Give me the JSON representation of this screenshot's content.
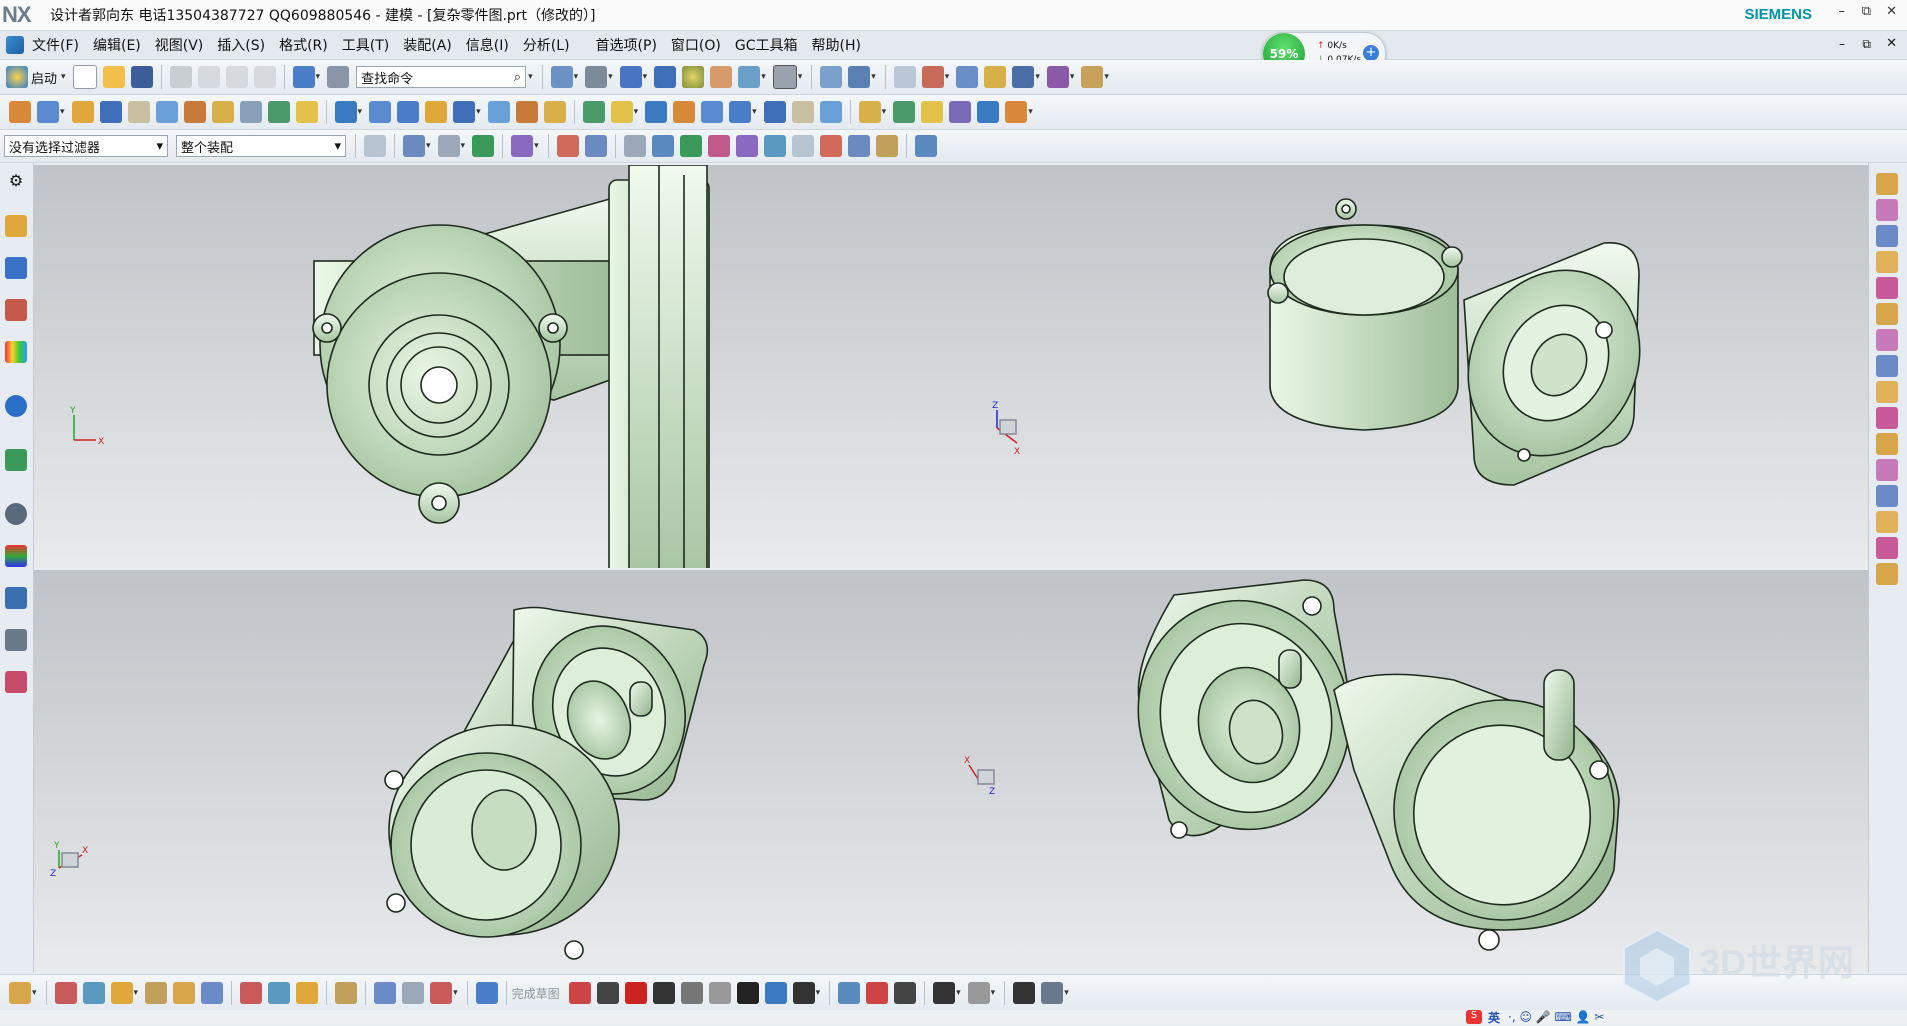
{
  "titlebar": {
    "logo": "NX",
    "title": "设计者郭向东  电话13504387727  QQ609880546 - 建模 - [复杂零件图.prt（修改的）]",
    "brand": "SIEMENS",
    "minimize": "–",
    "restore": "⧉",
    "close": "✕"
  },
  "menubar": {
    "items": [
      "文件(F)",
      "编辑(E)",
      "视图(V)",
      "插入(S)",
      "格式(R)",
      "工具(T)",
      "装配(A)",
      "信息(I)",
      "分析(L)",
      "首选项(P)",
      "窗口(O)",
      "GC工具箱",
      "帮助(H)"
    ]
  },
  "net_widget": {
    "cpu_percent": "59%",
    "upload": "0K/s",
    "download": "0.07K/s"
  },
  "toolbar": {
    "start_label": "启动",
    "command_search_placeholder": "查找命令",
    "selection_filter": "没有选择过滤器",
    "assembly_scope": "整个装配"
  },
  "sketch_toolbar": {
    "finish_sketch_label": "完成草图"
  },
  "watermark": {
    "text": "3D世界网"
  },
  "ime_bar": {
    "lang": "英"
  },
  "colors": {
    "part_fill": "#d7edd3",
    "part_shadow": "#8fae8c",
    "edge": "#1e2a1e",
    "viewport_top": "#c0c3c7",
    "viewport_bottom": "#e8eaec",
    "brand": "#0096a8"
  }
}
